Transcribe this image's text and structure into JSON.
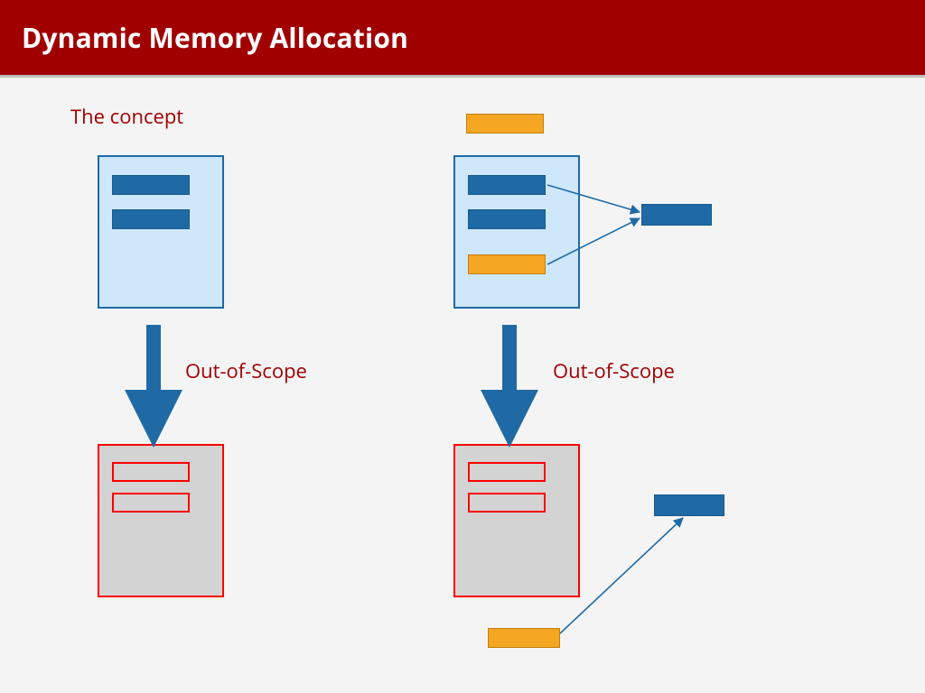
{
  "header": {
    "title": "Dynamic Memory Allocation"
  },
  "labels": {
    "concept": "The concept",
    "out_of_scope_left": "Out-of-Scope",
    "out_of_scope_right": "Out-of-Scope"
  },
  "colors": {
    "header_bg": "#a00000",
    "blue": "#1f6aa5",
    "blue_light": "#cfe7fb",
    "orange": "#f5a623",
    "red": "#ff0000",
    "grey": "#d3d3d3"
  },
  "diagram": {
    "description": "Two parallel vertical flows showing a memory block (stack frame) going out of scope. Left column: a blue scope box with two blue items transitions via a down arrow labeled 'Out-of-Scope' to a grey/red-outlined box. Right column: same scope box additionally holds an orange item and points to an external heap block; after out-of-scope the external block persists and is still referenced by the orange item now outside the dead frame, plus a stray orange block above the original frame.",
    "left": {
      "scope_box": {
        "items": [
          "value-a",
          "value-b"
        ],
        "style": "live"
      },
      "arrow_label": "Out-of-Scope",
      "dead_box": {
        "items": [
          "value-a",
          "value-b"
        ],
        "style": "dead"
      }
    },
    "right": {
      "stray_orange_above": true,
      "scope_box": {
        "items": [
          "value-a",
          "value-b",
          "orange-handle"
        ],
        "style": "live"
      },
      "heap_block_top": true,
      "pointers_from": [
        "value-a",
        "orange-handle"
      ],
      "arrow_label": "Out-of-Scope",
      "dead_box": {
        "items": [
          "value-a",
          "value-b"
        ],
        "style": "dead"
      },
      "heap_block_bottom": true,
      "orange_handle_below": true,
      "pointer_from_orange_below_to_heap_bottom": true
    }
  }
}
